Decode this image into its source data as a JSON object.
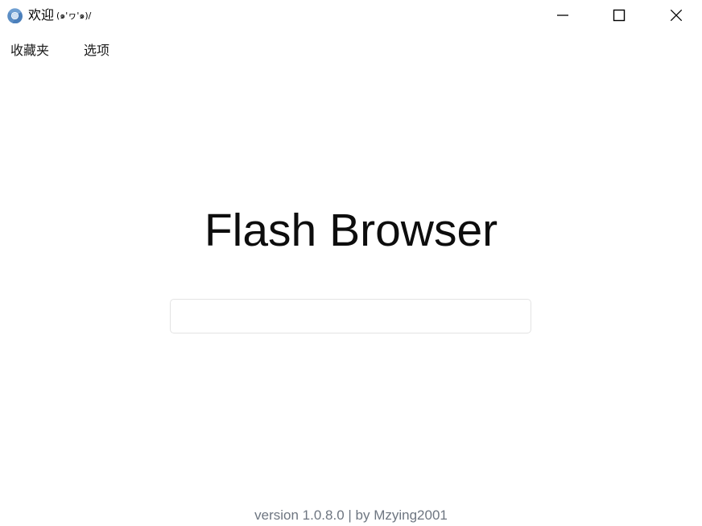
{
  "window": {
    "title": "欢迎",
    "title_kaomoji": "(๑'ヮ'๑)/",
    "icon": "chromium-logo-icon",
    "background_color": "#ffffff",
    "controls": {
      "minimize_label": "Minimize",
      "maximize_label": "Maximize",
      "close_label": "Close"
    }
  },
  "menubar": {
    "items": [
      {
        "label": "收藏夹",
        "name": "favorites"
      },
      {
        "label": "选项",
        "name": "options"
      }
    ]
  },
  "main": {
    "brand_title": "Flash Browser",
    "address_input": {
      "value": "",
      "placeholder": ""
    }
  },
  "footer": {
    "version_text": "version 1.0.8.0 | by Mzying2001",
    "version_color": "#6e7681"
  }
}
